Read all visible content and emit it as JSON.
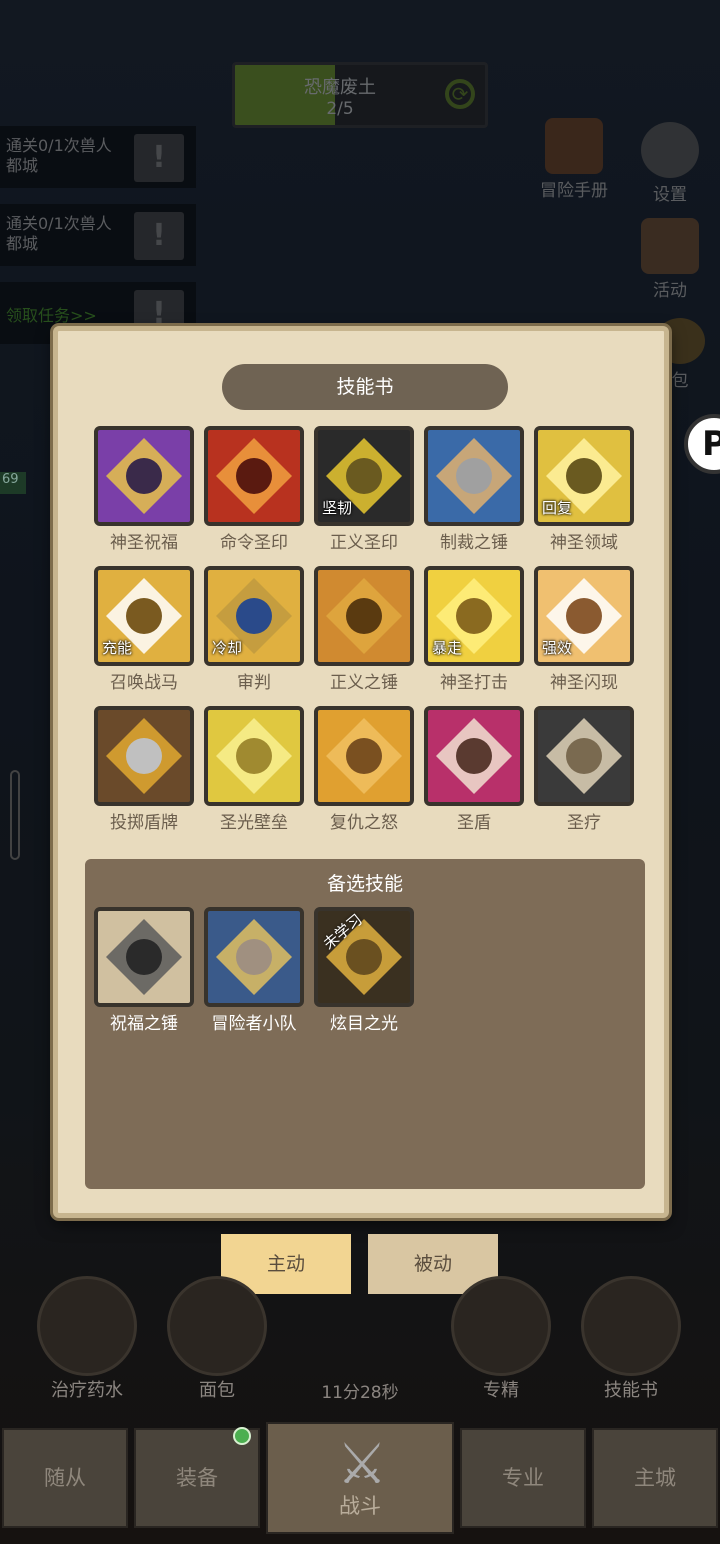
{
  "stage": {
    "name": "恐魔废土",
    "progress_text": "2/5",
    "progress": 0.4
  },
  "quests": [
    {
      "text": "通关0/1次兽人都城"
    },
    {
      "text": "通关0/1次兽人都城"
    },
    {
      "text": "领取任务>>"
    }
  ],
  "side_icons": {
    "handbook": "冒险手册",
    "settings": "设置",
    "activity": "活动",
    "bag_partial": "包"
  },
  "left_tag": "69",
  "modal": {
    "title": "技能书",
    "skills": [
      {
        "name": "神圣祝福",
        "tag": ""
      },
      {
        "name": "命令圣印",
        "tag": ""
      },
      {
        "name": "正义圣印",
        "tag": "坚韧"
      },
      {
        "name": "制裁之锤",
        "tag": ""
      },
      {
        "name": "神圣领域",
        "tag": "回复"
      },
      {
        "name": "召唤战马",
        "tag": "充能"
      },
      {
        "name": "审判",
        "tag": "冷却"
      },
      {
        "name": "正义之锤",
        "tag": ""
      },
      {
        "name": "神圣打击",
        "tag": "暴走"
      },
      {
        "name": "神圣闪现",
        "tag": "强效"
      },
      {
        "name": "投掷盾牌",
        "tag": ""
      },
      {
        "name": "圣光壁垒",
        "tag": ""
      },
      {
        "name": "复仇之怒",
        "tag": ""
      },
      {
        "name": "圣盾",
        "tag": ""
      },
      {
        "name": "圣疗",
        "tag": ""
      }
    ],
    "alt_title": "备选技能",
    "alt_skills": [
      {
        "name": "祝福之锤",
        "tag": ""
      },
      {
        "name": "冒险者小队",
        "tag": ""
      },
      {
        "name": "炫目之光",
        "tag": "未学习"
      }
    ]
  },
  "tabs": {
    "active": "主动",
    "passive": "被动"
  },
  "quickbar": {
    "potion": "治疗药水",
    "bread": "面包",
    "specialize": "专精",
    "skillbook": "技能书",
    "timer": "11分28秒"
  },
  "nav": {
    "followers": "随从",
    "equipment": "装备",
    "battle": "战斗",
    "profession": "专业",
    "main_city": "主城"
  }
}
